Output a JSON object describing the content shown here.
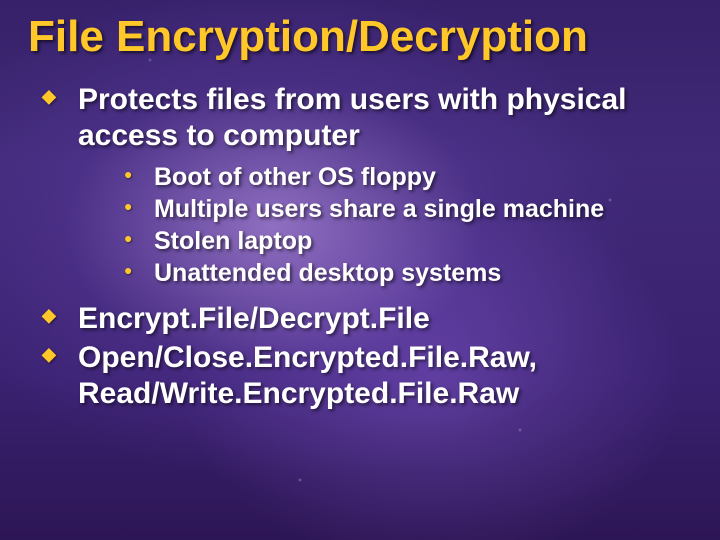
{
  "title": "File Encryption/Decryption",
  "bullets": [
    {
      "text": "Protects files from users with physical access to computer",
      "sub": [
        "Boot of other OS floppy",
        "Multiple users share a single machine",
        "Stolen laptop",
        "Unattended desktop systems"
      ]
    },
    {
      "text": "Encrypt.File/Decrypt.File",
      "sub": []
    },
    {
      "text": "Open/Close.Encrypted.File.Raw, Read/Write.Encrypted.File.Raw",
      "sub": []
    }
  ]
}
